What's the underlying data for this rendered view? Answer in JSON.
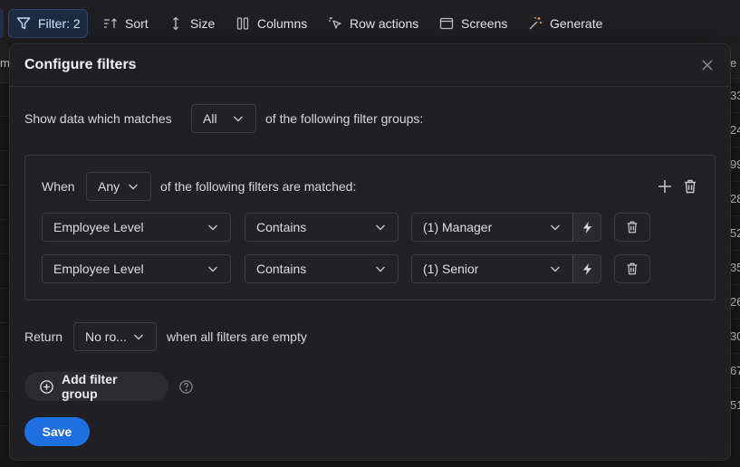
{
  "toolbar": {
    "items": [
      {
        "label": "Filter: 2",
        "icon": "filter-icon"
      },
      {
        "label": "Sort",
        "icon": "sort-icon"
      },
      {
        "label": "Size",
        "icon": "size-icon"
      },
      {
        "label": "Columns",
        "icon": "columns-icon"
      },
      {
        "label": "Row actions",
        "icon": "row-actions-icon"
      },
      {
        "label": "Screens",
        "icon": "screens-icon"
      },
      {
        "label": "Generate",
        "icon": "generate-icon"
      }
    ]
  },
  "background": {
    "left_header_text": "m",
    "right_cells": [
      "33",
      "24",
      "99",
      "28",
      "52",
      "35",
      "26",
      "30",
      "67",
      "51"
    ],
    "right_header_text": "e"
  },
  "modal": {
    "title": "Configure filters",
    "match_prefix": "Show data which matches",
    "match_value": "All",
    "match_suffix": "of the following filter groups:",
    "group": {
      "when_label": "When",
      "when_value": "Any",
      "when_suffix": "of the following filters are matched:",
      "filters": [
        {
          "field": "Employee Level",
          "operator": "Contains",
          "value": "(1) Manager"
        },
        {
          "field": "Employee Level",
          "operator": "Contains",
          "value": "(1) Senior"
        }
      ]
    },
    "return_label": "Return",
    "return_value": "No ro...",
    "return_suffix": "when all filters are empty",
    "add_group_label": "Add filter group",
    "save_label": "Save"
  },
  "colors": {
    "accent": "#1f6fe0",
    "background": "#1b1b1d",
    "panel": "#202022"
  }
}
